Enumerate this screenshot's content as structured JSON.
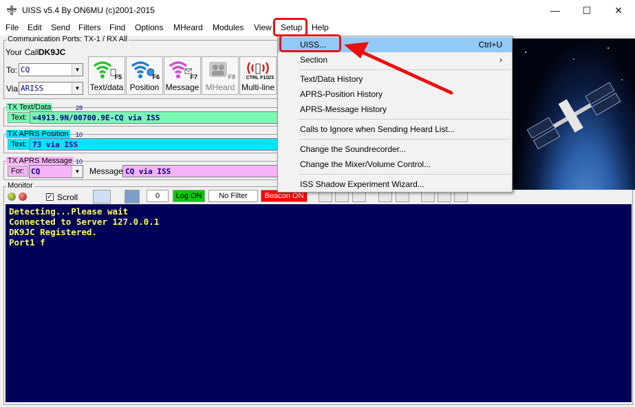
{
  "window": {
    "title": "UISS v5.4 By ON6MU (c)2001-2015",
    "controls": {
      "minimize": "—",
      "maximize": "☐",
      "close": "✕"
    }
  },
  "menubar": [
    "File",
    "Edit",
    "Send",
    "Filters",
    "Find",
    "Options",
    "MHeard",
    "Modules",
    "View",
    "Setup",
    "Help"
  ],
  "comm": {
    "frame_label": "Communication Ports: TX-1 / RX All",
    "your_call_label": "Your Call:",
    "your_call": "DK9JC",
    "to_label": "To:",
    "to_value": "CQ",
    "via_label": "Via:",
    "via_value": "ARISS"
  },
  "toolbar_buttons": [
    {
      "key": "F5",
      "label": "Text/data",
      "enabled": true
    },
    {
      "key": "F6",
      "label": "Position",
      "enabled": true
    },
    {
      "key": "F7",
      "label": "Message",
      "enabled": true
    },
    {
      "key": "F8",
      "label": "MHeard",
      "enabled": false
    },
    {
      "key": "CTRL F1/2/3",
      "label": "Multi-line",
      "enabled": true
    }
  ],
  "tx_text": {
    "label": "TX Text/Data",
    "count": "28",
    "field_label": "Text:",
    "value": "=4913.9N/00700.9E-CQ via ISS"
  },
  "tx_position": {
    "label": "TX APRS Position",
    "count": "10",
    "field_label": "Text:",
    "value": "73 via ISS"
  },
  "tx_message": {
    "label": "TX APRS Message",
    "count": "10",
    "for_label": "For:",
    "for_value": "CQ",
    "message_label": "Message:",
    "message_value": "CQ via ISS"
  },
  "monitor": {
    "label": "Monitor",
    "scroll_label": "Scroll",
    "scroll_checked": true,
    "counter": "0",
    "log_button": "Log ON",
    "filter_button": "No Filter",
    "beacon_button": "Beacon ON",
    "lines": [
      "Detecting...Please wait",
      "Connected to Server 127.0.0.1",
      "DK9JC Registered.",
      "Port1 f"
    ]
  },
  "setup_menu": {
    "items": [
      {
        "label": "UISS...",
        "shortcut": "Ctrl+U",
        "highlighted": true
      },
      {
        "label": "Section",
        "shortcut": "›"
      },
      {
        "label": "Text/Data History"
      },
      {
        "label": "APRS-Position History"
      },
      {
        "label": "APRS-Message History"
      },
      {
        "label": "Calls to Ignore when Sending Heard List..."
      },
      {
        "label": "Change the Soundrecorder..."
      },
      {
        "label": "Change the Mixer/Volume Control..."
      },
      {
        "label": "ISS Shadow Experiment Wizard..."
      }
    ]
  },
  "colors": {
    "text_field": "#7cf7b4",
    "position_field": "#00e5ff",
    "message_field": "#f7b3f7",
    "console_bg": "#000058",
    "console_text": "#ffff54",
    "log_on": "#00cc00",
    "beacon_on": "#ff0000",
    "annotation": "#e81010"
  }
}
